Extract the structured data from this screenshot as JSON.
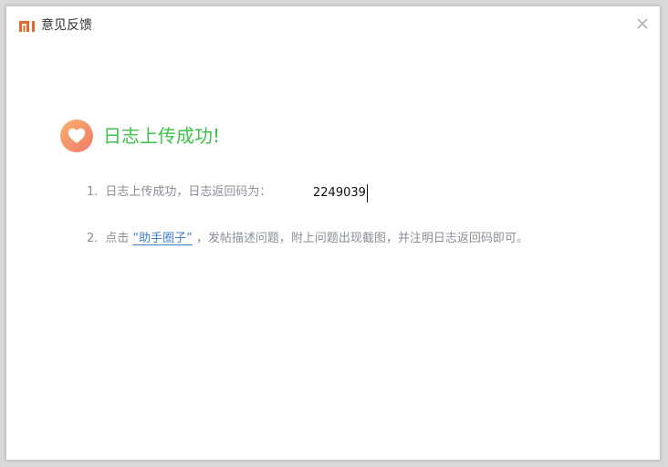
{
  "window": {
    "title": "意见反馈",
    "logo_icon": "mi-logo-icon",
    "close_icon": "close-icon"
  },
  "status": {
    "icon": "heart-icon",
    "title": "日志上传成功!"
  },
  "steps": [
    {
      "number": "1.",
      "text": "日志上传成功，日志返回码为：",
      "code": "2249039"
    },
    {
      "number": "2.",
      "text_before": "点击",
      "link": "“助手圈子”",
      "text_after": "，发帖描述问题，附上问题出现截图，并注明日志返回码即可。"
    }
  ],
  "colors": {
    "brand": "#e46a2e",
    "success": "#3cc24a",
    "link": "#3f7fc9",
    "muted_text": "#8a8f96"
  }
}
